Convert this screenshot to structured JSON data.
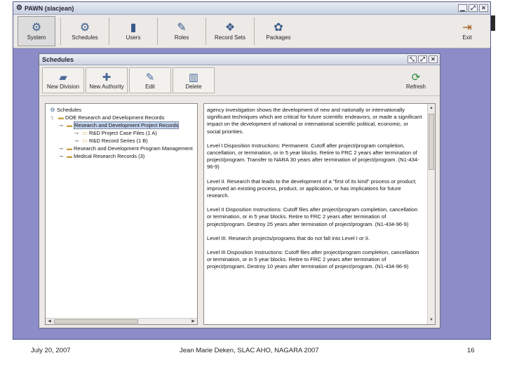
{
  "app": {
    "title": "PAWN (slacjean)",
    "toolbar": [
      {
        "label": "System",
        "icon": "gears-icon"
      },
      {
        "label": "Schedules",
        "icon": "schedule-gear-icon"
      },
      {
        "label": "Users",
        "icon": "users-icon"
      },
      {
        "label": "Roles",
        "icon": "roles-icon"
      },
      {
        "label": "Record Sets",
        "icon": "record-sets-icon"
      },
      {
        "label": "Packages",
        "icon": "packages-icon"
      }
    ],
    "exit_label": "Exit"
  },
  "schedules_window": {
    "title": "Schedules",
    "toolbar": {
      "new_division": "New Division",
      "new_authority": "New Authority",
      "edit": "Edit",
      "delete": "Delete",
      "refresh": "Refresh"
    },
    "tree": {
      "root": "Schedules",
      "items": [
        {
          "label": "DOE Research and Development Records",
          "level": 1,
          "expanded": true,
          "selected": false
        },
        {
          "label": "Research and Development Project Records",
          "level": 1,
          "expanded": false,
          "selected": true
        },
        {
          "label": "R&D Project Case Files (1 A)",
          "level": 2,
          "expanded": false,
          "selected": false
        },
        {
          "label": "R&D Record Series (1 B)",
          "level": 2,
          "expanded": false,
          "selected": false
        },
        {
          "label": "Research and Development Program Management",
          "level": 1,
          "expanded": false,
          "selected": false
        },
        {
          "label": "Medical Research Records (3)",
          "level": 1,
          "expanded": false,
          "selected": false
        }
      ]
    },
    "detail_paragraphs": [
      "agency investigation shows the development of new and nationally or internationally significant techniques which are critical for future scientific endeavors, or made a significant impact on the development of national or international scientific political, economic, or social priorities.",
      "Level I Disposition Instructions: Permanent. Cutoff after project/program completion, cancellation, or termination, or in 5 year blocks. Retire to FRC 2 years after termination of project/program. Transfer to NARA 30 years after termination of project/program. (N1-434-96-9)",
      "Level II. Research that leads to the development of a \"first of its kind\" process or product; improved an existing process, product, or application, or has implications for future research.",
      "Level II Disposition Instructions: Cutoff files after project/program completion, cancellation or termination, or in 5 year blocks. Retire to FRC 2 years after termination of project/program. Destroy 25 years after termination of project/program. (N1-434-96-9)",
      "Level III. Research projects/programs that do not fall into Level I or II.",
      "Level III Disposition Instructions: Cutoff files after project/program completion, cancellation or termination, or in 5 year blocks. Retire to FRC 2 years after termination of project/program. Destroy 10 years after termination of project/program. (N1-434-96-9)"
    ]
  },
  "footer": {
    "date": "July 20, 2007",
    "center": "Jean Marie Deken, SLAC AHO, NAGARA 2007",
    "page": "16"
  },
  "colors": {
    "desktop": "#8c8cc8",
    "window_bg": "#ece9e6",
    "selection": "#c3d3ee"
  }
}
